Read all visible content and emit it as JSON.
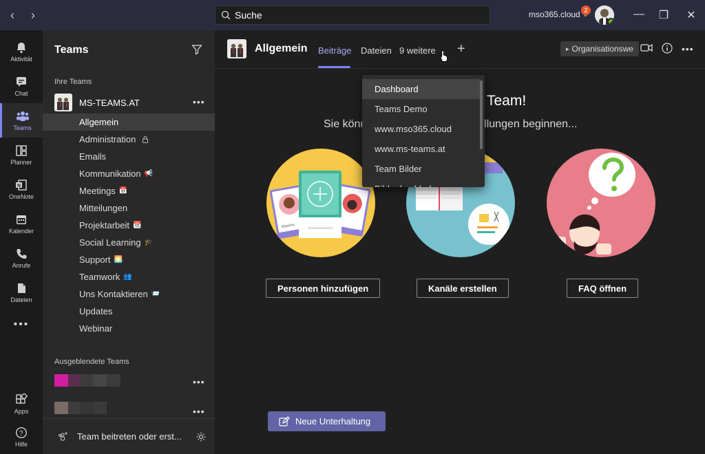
{
  "titlebar": {
    "search_placeholder": "Suche",
    "tenant": "mso365.cloud",
    "notification_count": "2"
  },
  "rail": [
    {
      "label": "Aktivität",
      "icon": "bell-icon"
    },
    {
      "label": "Chat",
      "icon": "chat-icon"
    },
    {
      "label": "Teams",
      "icon": "teams-icon",
      "active": true
    },
    {
      "label": "Planner",
      "icon": "planner-icon"
    },
    {
      "label": "OneNote",
      "icon": "onenote-icon"
    },
    {
      "label": "Kalender",
      "icon": "calendar-icon"
    },
    {
      "label": "Anrufe",
      "icon": "phone-icon"
    },
    {
      "label": "Dateien",
      "icon": "file-icon"
    },
    {
      "label": "",
      "icon": "more-apps-icon"
    },
    {
      "label": "Apps",
      "icon": "apps-icon"
    },
    {
      "label": "Hilfe",
      "icon": "help-icon"
    }
  ],
  "sidebar": {
    "title": "Teams",
    "your_teams": "Ihre Teams",
    "team_name": "MS-TEAMS.AT",
    "channels": [
      {
        "label": "Allgemein",
        "active": true,
        "emoji": ""
      },
      {
        "label": "Administration",
        "emoji": "🔒"
      },
      {
        "label": "Emails",
        "emoji": ""
      },
      {
        "label": "Kommunikation",
        "emoji": "📢"
      },
      {
        "label": "Meetings",
        "emoji": "📅"
      },
      {
        "label": "Mitteilungen",
        "emoji": ""
      },
      {
        "label": "Projektarbeit",
        "emoji": "📆"
      },
      {
        "label": "Social Learning",
        "emoji": "🎓"
      },
      {
        "label": "Support",
        "emoji": "🌅"
      },
      {
        "label": "Teamwork",
        "emoji": "👥"
      },
      {
        "label": "Uns Kontaktieren",
        "emoji": "📨"
      },
      {
        "label": "Updates",
        "emoji": ""
      },
      {
        "label": "Webinar",
        "emoji": ""
      }
    ],
    "hidden_teams": "Ausgeblendete Teams",
    "footer": "Team beitreten oder erst..."
  },
  "channel_header": {
    "title": "Allgemein",
    "tabs": [
      "Beiträge",
      "Dateien",
      "9 weitere"
    ],
    "org_button": "Organisationswe"
  },
  "welcome": {
    "title_visible": "Team!",
    "subtitle_left": "Sie könn",
    "subtitle_right": "ellungen beginnen..."
  },
  "actions": {
    "add_people": "Personen hinzufügen",
    "create_channels": "Kanäle erstellen",
    "faq": "FAQ öffnen",
    "new_conversation": "Neue Unterhaltung"
  },
  "illustration_text": {
    "card_name": "Maxine"
  },
  "dropdown": {
    "items": [
      "Dashboard",
      "Teams Demo",
      "www.mso365.cloud",
      "www.ms-teams.at",
      "Team Bilder",
      "Bilder hochladen"
    ]
  },
  "colors": {
    "accent": "#6264a7",
    "accent_light": "#a8abf5",
    "titlebar": "#2b2b40"
  }
}
